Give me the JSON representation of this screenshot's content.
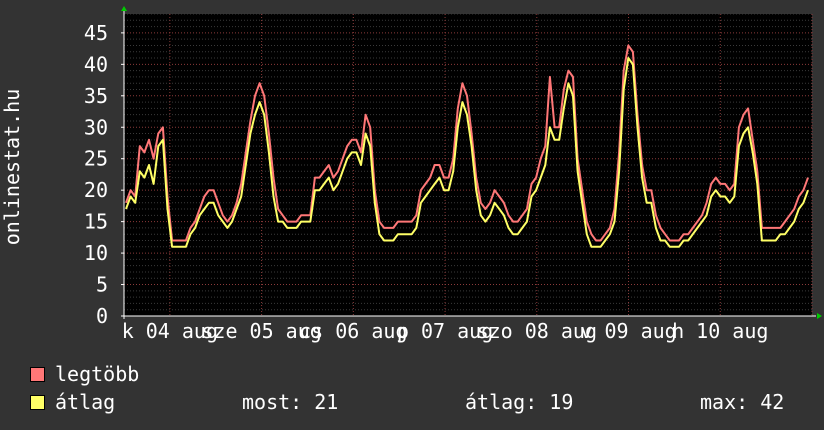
{
  "chart_data": {
    "type": "line",
    "ylabel": "onlinestat.hu",
    "ylim": [
      0,
      48
    ],
    "yticks": [
      0,
      5,
      10,
      15,
      20,
      25,
      30,
      35,
      40,
      45
    ],
    "x_tick_labels": [
      "k 04 aug",
      "sze 05 aug",
      "cs 06 aug",
      "p 07 aug",
      "szo 08 aug",
      "v 09 aug",
      "h 10 aug"
    ],
    "grid": true,
    "series": [
      {
        "name": "legtöbb",
        "color": "#ff7777",
        "values": [
          18,
          20,
          19,
          27,
          26,
          28,
          25,
          29,
          30,
          19,
          12,
          12,
          12,
          12,
          14,
          15,
          17,
          19,
          20,
          20,
          18,
          16,
          15,
          16,
          18,
          21,
          26,
          31,
          35,
          37,
          35,
          29,
          22,
          17,
          16,
          15,
          15,
          15,
          16,
          16,
          16,
          22,
          22,
          23,
          24,
          22,
          23,
          25,
          27,
          28,
          28,
          26,
          32,
          30,
          20,
          15,
          14,
          14,
          14,
          15,
          15,
          15,
          15,
          16,
          20,
          21,
          22,
          24,
          24,
          22,
          22,
          25,
          33,
          37,
          35,
          29,
          22,
          18,
          17,
          18,
          20,
          19,
          18,
          16,
          15,
          15,
          16,
          17,
          21,
          22,
          25,
          27,
          38,
          30,
          30,
          36,
          39,
          38,
          25,
          20,
          15,
          13,
          12,
          12,
          13,
          14,
          17,
          26,
          39,
          43,
          42,
          32,
          24,
          20,
          20,
          16,
          14,
          13,
          12,
          12,
          12,
          13,
          13,
          14,
          15,
          16,
          18,
          21,
          22,
          21,
          21,
          20,
          21,
          30,
          32,
          33,
          28,
          23,
          14,
          14,
          14,
          14,
          14,
          15,
          16,
          17,
          19,
          20,
          22
        ]
      },
      {
        "name": "átlag",
        "color": "#ffff66",
        "values": [
          17,
          19,
          18,
          23,
          22,
          24,
          21,
          27,
          28,
          17,
          11,
          11,
          11,
          11,
          13,
          14,
          16,
          17,
          18,
          18,
          16,
          15,
          14,
          15,
          17,
          19,
          24,
          29,
          32,
          34,
          32,
          26,
          19,
          15,
          15,
          14,
          14,
          14,
          15,
          15,
          15,
          20,
          20,
          21,
          22,
          20,
          21,
          23,
          25,
          26,
          26,
          24,
          29,
          27,
          18,
          13,
          12,
          12,
          12,
          13,
          13,
          13,
          13,
          14,
          18,
          19,
          20,
          21,
          22,
          20,
          20,
          23,
          30,
          34,
          32,
          27,
          20,
          16,
          15,
          16,
          18,
          17,
          16,
          14,
          13,
          13,
          14,
          15,
          19,
          20,
          22,
          24,
          30,
          28,
          28,
          33,
          37,
          35,
          23,
          18,
          13,
          11,
          11,
          11,
          12,
          13,
          15,
          23,
          36,
          41,
          40,
          30,
          22,
          18,
          18,
          14,
          12,
          12,
          11,
          11,
          11,
          12,
          12,
          13,
          14,
          15,
          16,
          19,
          20,
          19,
          19,
          18,
          19,
          27,
          29,
          30,
          26,
          21,
          12,
          12,
          12,
          12,
          13,
          13,
          14,
          15,
          17,
          18,
          20
        ]
      }
    ]
  },
  "legend": {
    "items": [
      {
        "label": "legtöbb",
        "color": "#ff7777"
      },
      {
        "label": "átlag",
        "color": "#ffff66"
      }
    ],
    "stats": {
      "now": "most: 21",
      "avg": "átlag: 19",
      "max": "max: 42"
    }
  }
}
